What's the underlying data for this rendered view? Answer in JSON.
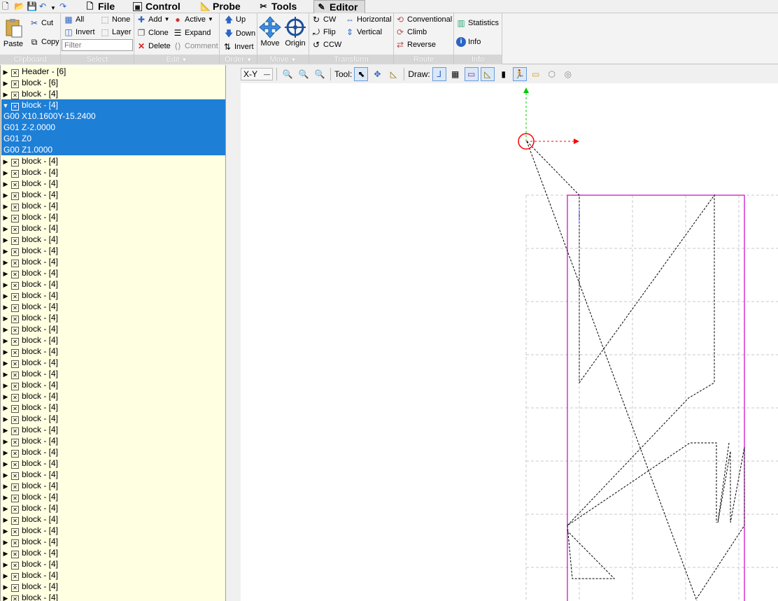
{
  "menubar": {
    "tabs": [
      {
        "label": "File",
        "icon": "file-icon"
      },
      {
        "label": "Control",
        "icon": "control-icon"
      },
      {
        "label": "Probe",
        "icon": "probe-icon"
      },
      {
        "label": "Tools",
        "icon": "tools-icon"
      },
      {
        "label": "Editor",
        "icon": "editor-icon",
        "active": true
      }
    ]
  },
  "ribbon": {
    "clipboard": {
      "label": "Clipboard",
      "paste": "Paste",
      "cut": "Cut",
      "copy": "Copy"
    },
    "select": {
      "label": "Select",
      "all": "All",
      "none": "None",
      "invert": "Invert",
      "layer": "Layer",
      "filter_placeholder": "Filter"
    },
    "edit": {
      "label": "Edit",
      "add": "Add",
      "active": "Active",
      "clone": "Clone",
      "expand": "Expand",
      "delete": "Delete",
      "comment": "Comment"
    },
    "order": {
      "label": "Order",
      "up": "Up",
      "down": "Down",
      "invert": "Invert"
    },
    "move": {
      "label": "Move",
      "move": "Move",
      "origin": "Origin"
    },
    "transform": {
      "label": "Transform",
      "cw": "CW",
      "flip": "Flip",
      "ccw": "CCW",
      "horizontal": "Horizontal",
      "vertical": "Vertical"
    },
    "route": {
      "label": "Route",
      "conventional": "Conventional",
      "climb": "Climb",
      "reverse": "Reverse"
    },
    "info": {
      "label": "Info",
      "statistics": "Statistics",
      "info": "Info"
    }
  },
  "tree": {
    "header": "Header - [6]",
    "block1": "block - [6]",
    "block2": "block - [4]",
    "open_block": "block - [4]",
    "gcode": [
      "G00 X10.1600Y-15.2400",
      "G01 Z-2.0000",
      "G01 Z0",
      "G00 Z1.0000"
    ],
    "block_label": "block - [4]",
    "remaining_count": 40
  },
  "canvas_toolbar": {
    "view": "X-Y",
    "tool_label": "Tool:",
    "draw_label": "Draw:"
  },
  "colors": {
    "selection": "#1e7fd6",
    "tree_bg": "#ffffe1",
    "margin": "#cc00cc",
    "axis_x": "#ff0000",
    "axis_y": "#00cc00"
  }
}
